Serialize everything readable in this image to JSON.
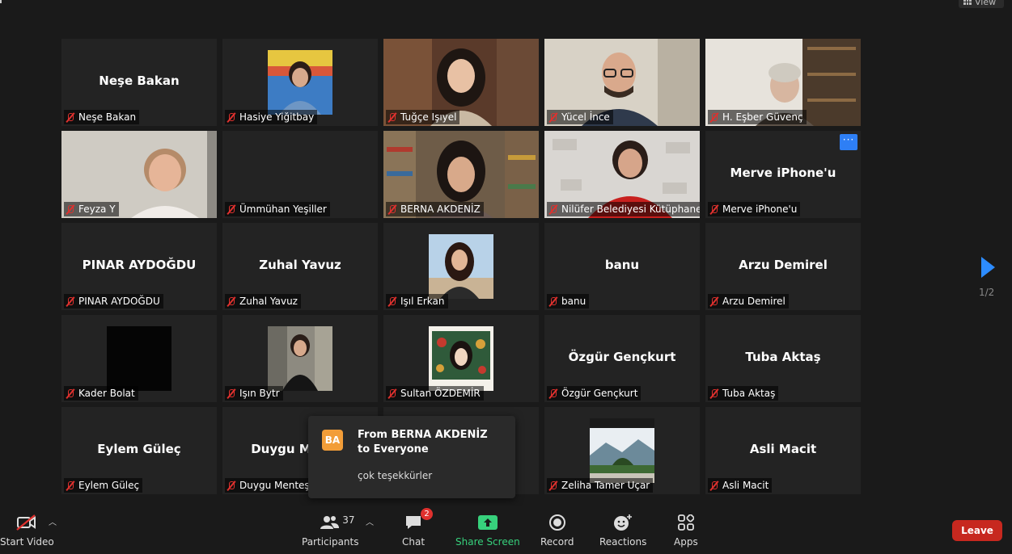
{
  "window": {
    "view_label": "View"
  },
  "gallery": {
    "active_speaker": "Tuğçe Işıyel",
    "tiles": [
      {
        "name": "Neşe Bakan",
        "display": "Neşe Bakan",
        "type": "text"
      },
      {
        "name": "Hasiye Yiğitbay",
        "type": "thumb",
        "scene": "woman-blue"
      },
      {
        "name": "Tuğçe Işıyel",
        "type": "video",
        "scene": "woman-brick",
        "active": true
      },
      {
        "name": "Yücel İnce",
        "type": "video",
        "scene": "man-glasses"
      },
      {
        "name": "H. Eşber Güvenç",
        "type": "video",
        "scene": "woman-bookshelf"
      },
      {
        "name": "Feyza Y",
        "type": "video",
        "scene": "woman-smile"
      },
      {
        "name": "Ümmühan Yeşiller",
        "type": "blank"
      },
      {
        "name": "BERNA AKDENİZ",
        "type": "video",
        "scene": "woman-books"
      },
      {
        "name": "Nilüfer Belediyesi Kütüphaneleri",
        "type": "video",
        "scene": "woman-red"
      },
      {
        "name": "Merve iPhone'u",
        "display": "Merve iPhone'u",
        "type": "text",
        "menu": true
      },
      {
        "name": "PINAR AYDOĞDU",
        "display": "PINAR AYDOĞDU",
        "type": "text"
      },
      {
        "name": "Zuhal Yavuz",
        "display": "Zuhal Yavuz",
        "type": "text"
      },
      {
        "name": "Işıl Erkan",
        "type": "thumb",
        "scene": "woman-sky"
      },
      {
        "name": "banu",
        "display": "banu",
        "type": "text"
      },
      {
        "name": "Arzu Demirel",
        "display": "Arzu Demirel",
        "type": "text"
      },
      {
        "name": "Kader Bolat",
        "type": "thumb",
        "scene": "dark"
      },
      {
        "name": "Işın Bytr",
        "type": "thumb",
        "scene": "woman-street"
      },
      {
        "name": "Sultan ÖZDEMİR",
        "type": "thumb",
        "scene": "painting"
      },
      {
        "name": "Özgür Gençkurt",
        "display": "Özgür Gençkurt",
        "type": "text"
      },
      {
        "name": "Tuba Aktaş",
        "display": "Tuba Aktaş",
        "type": "text"
      },
      {
        "name": "Eylem Güleç",
        "display": "Eylem Güleç",
        "type": "text"
      },
      {
        "name": "Duygu Menteş",
        "display": "Duygu Menteş",
        "type": "text"
      },
      {
        "name": "",
        "type": "blank",
        "hidden_label": true
      },
      {
        "name": "Zeliha Tamer Uçar",
        "type": "thumb",
        "scene": "landscape"
      },
      {
        "name": "Asli Macit",
        "display": "Asli Macit",
        "type": "text"
      }
    ]
  },
  "pagination": {
    "indicator": "1/2"
  },
  "chat_toast": {
    "avatar_initials": "BA",
    "from_line": "From BERNA AKDENİZ to Everyone",
    "message": "çok teşekkürler"
  },
  "toolbar": {
    "start_video": "Start Video",
    "participants": "Participants",
    "participants_count": "37",
    "chat": "Chat",
    "chat_badge": "2",
    "share_screen": "Share Screen",
    "record": "Record",
    "reactions": "Reactions",
    "apps": "Apps",
    "leave": "Leave"
  },
  "colors": {
    "active_outline": "#d9e35c",
    "mute_red": "#e0312e",
    "share_green": "#37d17c",
    "leave_red": "#c7281f",
    "accent_blue": "#2d8cff"
  }
}
